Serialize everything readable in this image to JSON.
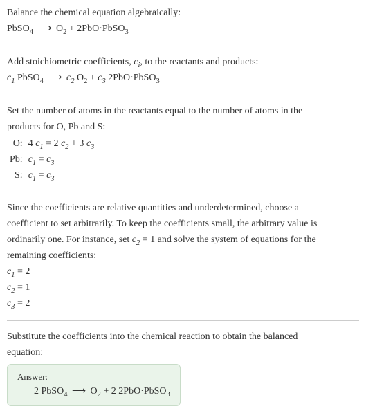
{
  "section1": {
    "line1_a": "Balance the chemical equation algebraically:",
    "eq_pbso4": "PbSO",
    "eq_4": "4",
    "eq_arrow": "⟶",
    "eq_o": "O",
    "eq_2": "2",
    "eq_plus": " + ",
    "eq_2pbo": "2PbO·PbSO",
    "eq_3": "3"
  },
  "section2": {
    "line1": "Add stoichiometric coefficients, ",
    "ci": "c",
    "ci_sub": "i",
    "line1b": ", to the reactants and products:",
    "c1": "c",
    "sub1": "1",
    "pbso4": " PbSO",
    "sub4": "4",
    "arrow": "⟶",
    "c2": "c",
    "sub2": "2",
    "o2": " O",
    "o2sub": "2",
    "plus": " + ",
    "c3": "c",
    "sub3": "3",
    "prod": " 2PbO·PbSO",
    "prodsub": "3"
  },
  "section3": {
    "intro1": "Set the number of atoms in the reactants equal to the number of atoms in the",
    "intro2": "products for O, Pb and S:",
    "rows": {
      "o_label": "O:",
      "o_eq_a": "4 ",
      "o_eq_c1": "c",
      "o_eq_s1": "1",
      "o_eq_b": " = 2 ",
      "o_eq_c2": "c",
      "o_eq_s2": "2",
      "o_eq_c": " + 3 ",
      "o_eq_c3": "c",
      "o_eq_s3": "3",
      "pb_label": "Pb:",
      "pb_c1": "c",
      "pb_s1": "1",
      "pb_eq": " = ",
      "pb_c3": "c",
      "pb_s3": "3",
      "s_label": "S:",
      "s_c1": "c",
      "s_s1": "1",
      "s_eq": " = ",
      "s_c3": "c",
      "s_s3": "3"
    }
  },
  "section4": {
    "p1": "Since the coefficients are relative quantities and underdetermined, choose a",
    "p2": "coefficient to set arbitrarily. To keep the coefficients small, the arbitrary value is",
    "p3a": "ordinarily one. For instance, set ",
    "p3_c": "c",
    "p3_sub": "2",
    "p3_eq": " = 1",
    "p3b": " and solve the system of equations for the",
    "p4": "remaining coefficients:",
    "r1_c": "c",
    "r1_s": "1",
    "r1_v": " = 2",
    "r2_c": "c",
    "r2_s": "2",
    "r2_v": " = 1",
    "r3_c": "c",
    "r3_s": "3",
    "r3_v": " = 2"
  },
  "section5": {
    "p1": "Substitute the coefficients into the chemical reaction to obtain the balanced",
    "p2": "equation:",
    "answer_label": "Answer:",
    "eq_a": "2 PbSO",
    "eq_a_sub": "4",
    "eq_arrow": "⟶",
    "eq_b": "O",
    "eq_b_sub": "2",
    "eq_plus": " + ",
    "eq_c": "2 2PbO·PbSO",
    "eq_c_sub": "3"
  }
}
